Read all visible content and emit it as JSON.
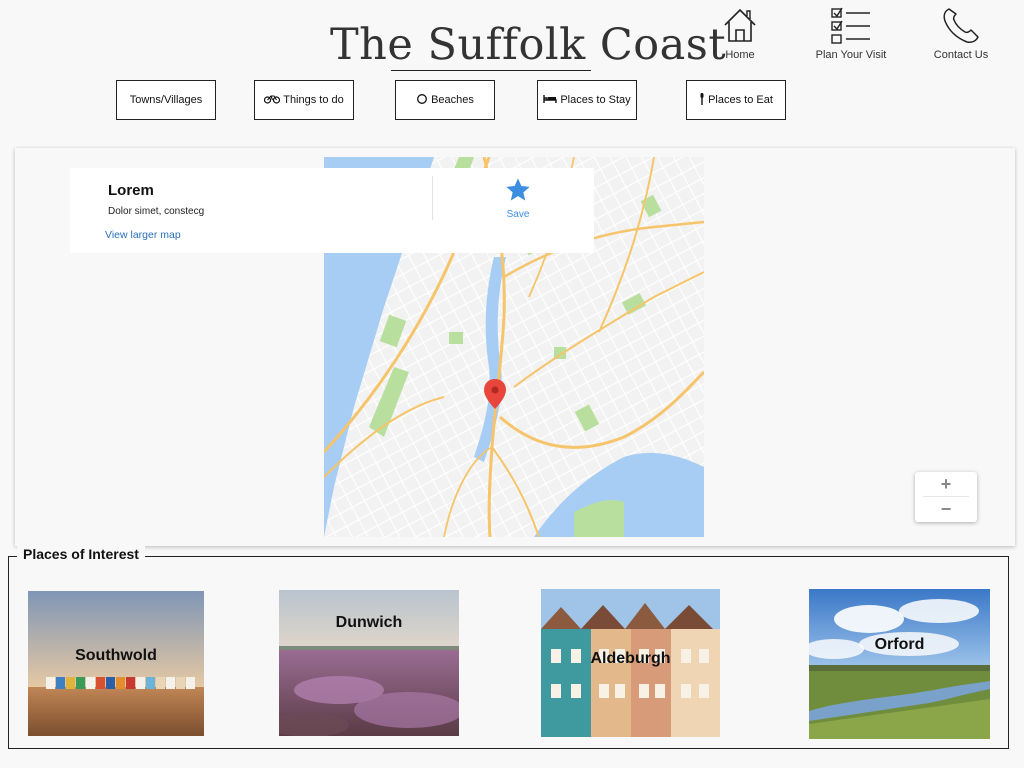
{
  "site": {
    "title": "The Suffolk Coast"
  },
  "topnav": [
    {
      "label": "Home",
      "icon": "home-icon"
    },
    {
      "label": "Plan Your Visit",
      "icon": "checklist-icon"
    },
    {
      "label": "Contact Us",
      "icon": "phone-icon"
    }
  ],
  "categories": [
    {
      "label": "Towns/Villages",
      "icon": ""
    },
    {
      "label": "Things to do",
      "icon": "bicycle-icon"
    },
    {
      "label": "Beaches",
      "icon": "sun-icon"
    },
    {
      "label": "Places to Stay",
      "icon": "bed-icon"
    },
    {
      "label": "Places to Eat",
      "icon": "cutlery-icon"
    }
  ],
  "map": {
    "info": {
      "name": "Lorem",
      "address": "Dolor simet, constecg",
      "link": "View larger map",
      "save": "Save"
    },
    "zoom": {
      "in": "+",
      "out": "−"
    },
    "colors": {
      "water": "#a8cdf5",
      "park": "#b9df9e",
      "road": "#f6c46a",
      "pin": "#e8453c",
      "star": "#3b8ee0"
    }
  },
  "poi": {
    "legend": "Places of Interest",
    "places": [
      "Southwold",
      "Dunwich",
      "Aldeburgh",
      "Orford"
    ]
  }
}
